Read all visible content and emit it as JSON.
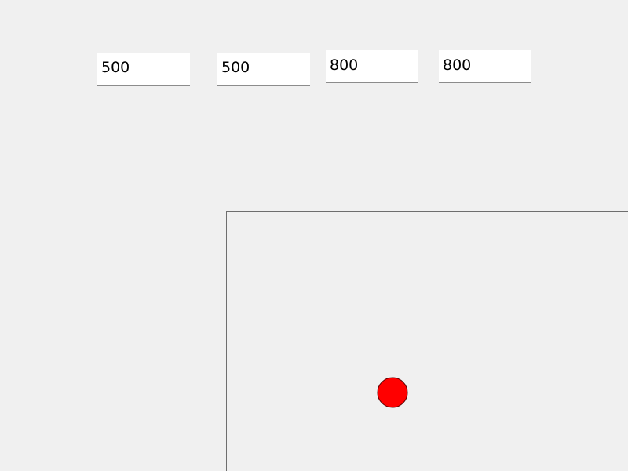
{
  "fields": {
    "field_1": "500",
    "field_2": "500",
    "field_3": "800",
    "field_4": "800"
  },
  "canvas": {
    "ball_color": "#ff0000",
    "ball_outline": "#5a0000",
    "border_color": "#6e6e6e"
  }
}
